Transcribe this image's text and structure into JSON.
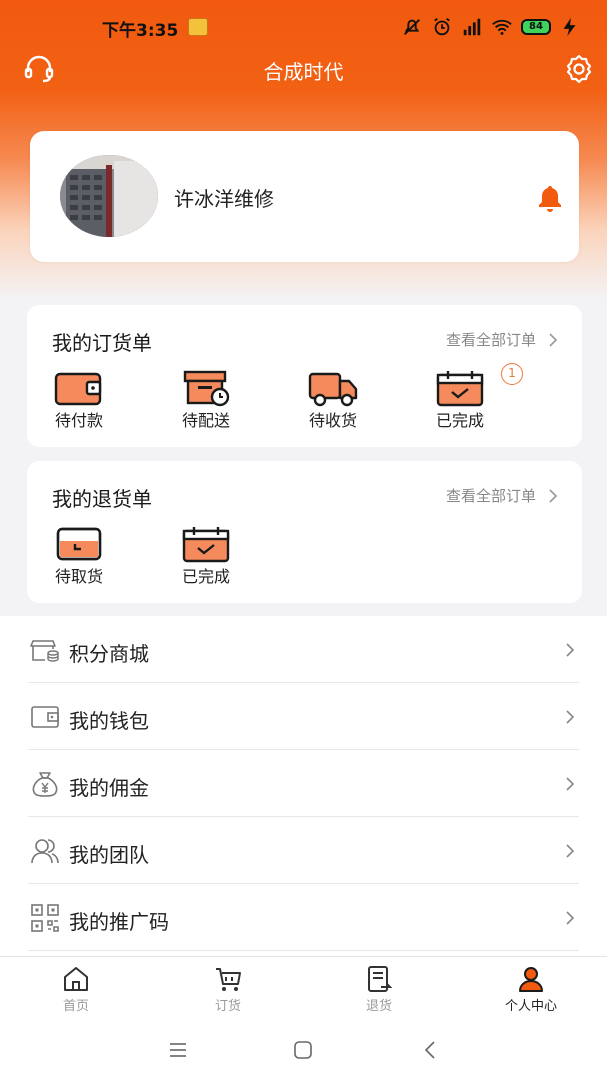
{
  "status_bar": {
    "time": "下午3:35",
    "battery": "84"
  },
  "header": {
    "title": "合成时代"
  },
  "profile": {
    "name": "许冰洋维修"
  },
  "orders": {
    "title": "我的订货单",
    "view_all": "查看全部订单",
    "items": [
      {
        "label": "待付款",
        "icon": "wallet-icon"
      },
      {
        "label": "待配送",
        "icon": "box-clock-icon"
      },
      {
        "label": "待收货",
        "icon": "truck-icon"
      },
      {
        "label": "已完成",
        "icon": "calendar-check-icon",
        "badge": "1"
      }
    ]
  },
  "returns": {
    "title": "我的退货单",
    "view_all": "查看全部订单",
    "items": [
      {
        "label": "待取货",
        "icon": "pickup-box-icon"
      },
      {
        "label": "已完成",
        "icon": "calendar-check-icon"
      }
    ]
  },
  "menu": {
    "items": [
      {
        "label": "积分商城",
        "icon": "store-coins-icon"
      },
      {
        "label": "我的钱包",
        "icon": "wallet-outline-icon"
      },
      {
        "label": "我的佣金",
        "icon": "money-bag-icon"
      },
      {
        "label": "我的团队",
        "icon": "team-icon"
      },
      {
        "label": "我的推广码",
        "icon": "qr-code-icon"
      }
    ]
  },
  "bottom_nav": {
    "items": [
      {
        "label": "首页",
        "icon": "home-icon"
      },
      {
        "label": "订货",
        "icon": "cart-icon"
      },
      {
        "label": "退货",
        "icon": "return-doc-icon"
      },
      {
        "label": "个人中心",
        "icon": "person-icon",
        "active": true
      }
    ]
  },
  "colors": {
    "accent": "#f15a0f",
    "icon_fill": "#f58a5c",
    "badge": "#f0783a"
  }
}
